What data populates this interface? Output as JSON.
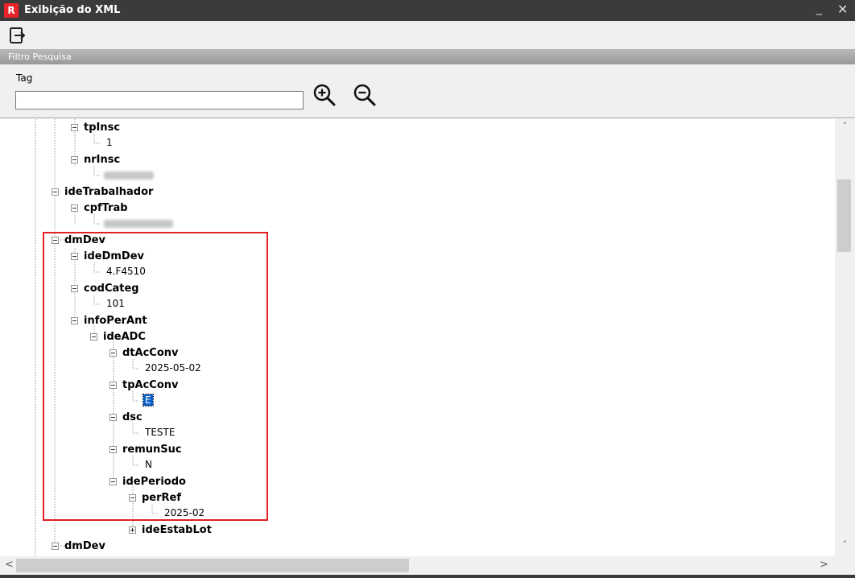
{
  "window": {
    "title": "Exibição do XML",
    "min_glyph": "_",
    "close_glyph": "✕",
    "app_icon_glyph": "R"
  },
  "toolbar": {
    "exit_icon": "exit-icon"
  },
  "filter": {
    "section_title": "Filtro Pesquisa",
    "tag_label": "Tag",
    "tag_value": "",
    "zoom_in_icon": "zoom-in-icon",
    "zoom_out_icon": "zoom-out-icon"
  },
  "tree": {
    "nodes": {
      "tpInsc": "tpInsc",
      "tpInsc_value": "1",
      "nrInsc": "nrInsc",
      "ideTrabalhador": "ideTrabalhador",
      "cpfTrab": "cpfTrab",
      "dmDev": "dmDev",
      "ideDmDev": "ideDmDev",
      "ideDmDev_value": "4.F4510",
      "codCateg": "codCateg",
      "codCateg_value": "101",
      "infoPerAnt": "infoPerAnt",
      "ideADC": "ideADC",
      "dtAcConv": "dtAcConv",
      "dtAcConv_value": "2025-05-02",
      "tpAcConv": "tpAcConv",
      "tpAcConv_value": "E",
      "dsc": "dsc",
      "dsc_value": "TESTE",
      "remunSuc": "remunSuc",
      "remunSuc_value": "N",
      "idePeriodo": "idePeriodo",
      "perRef": "perRef",
      "perRef_value": "2025-02",
      "ideEstabLot": "ideEstabLot",
      "dmDev2": "dmDev"
    }
  },
  "scroll": {
    "up_glyph": "˄",
    "down_glyph": "˅",
    "left_glyph": "<",
    "right_glyph": ">"
  },
  "colors": {
    "titlebar": "#3b3b3b",
    "highlight": "#e31e24",
    "selection": "#0a5fc7"
  }
}
